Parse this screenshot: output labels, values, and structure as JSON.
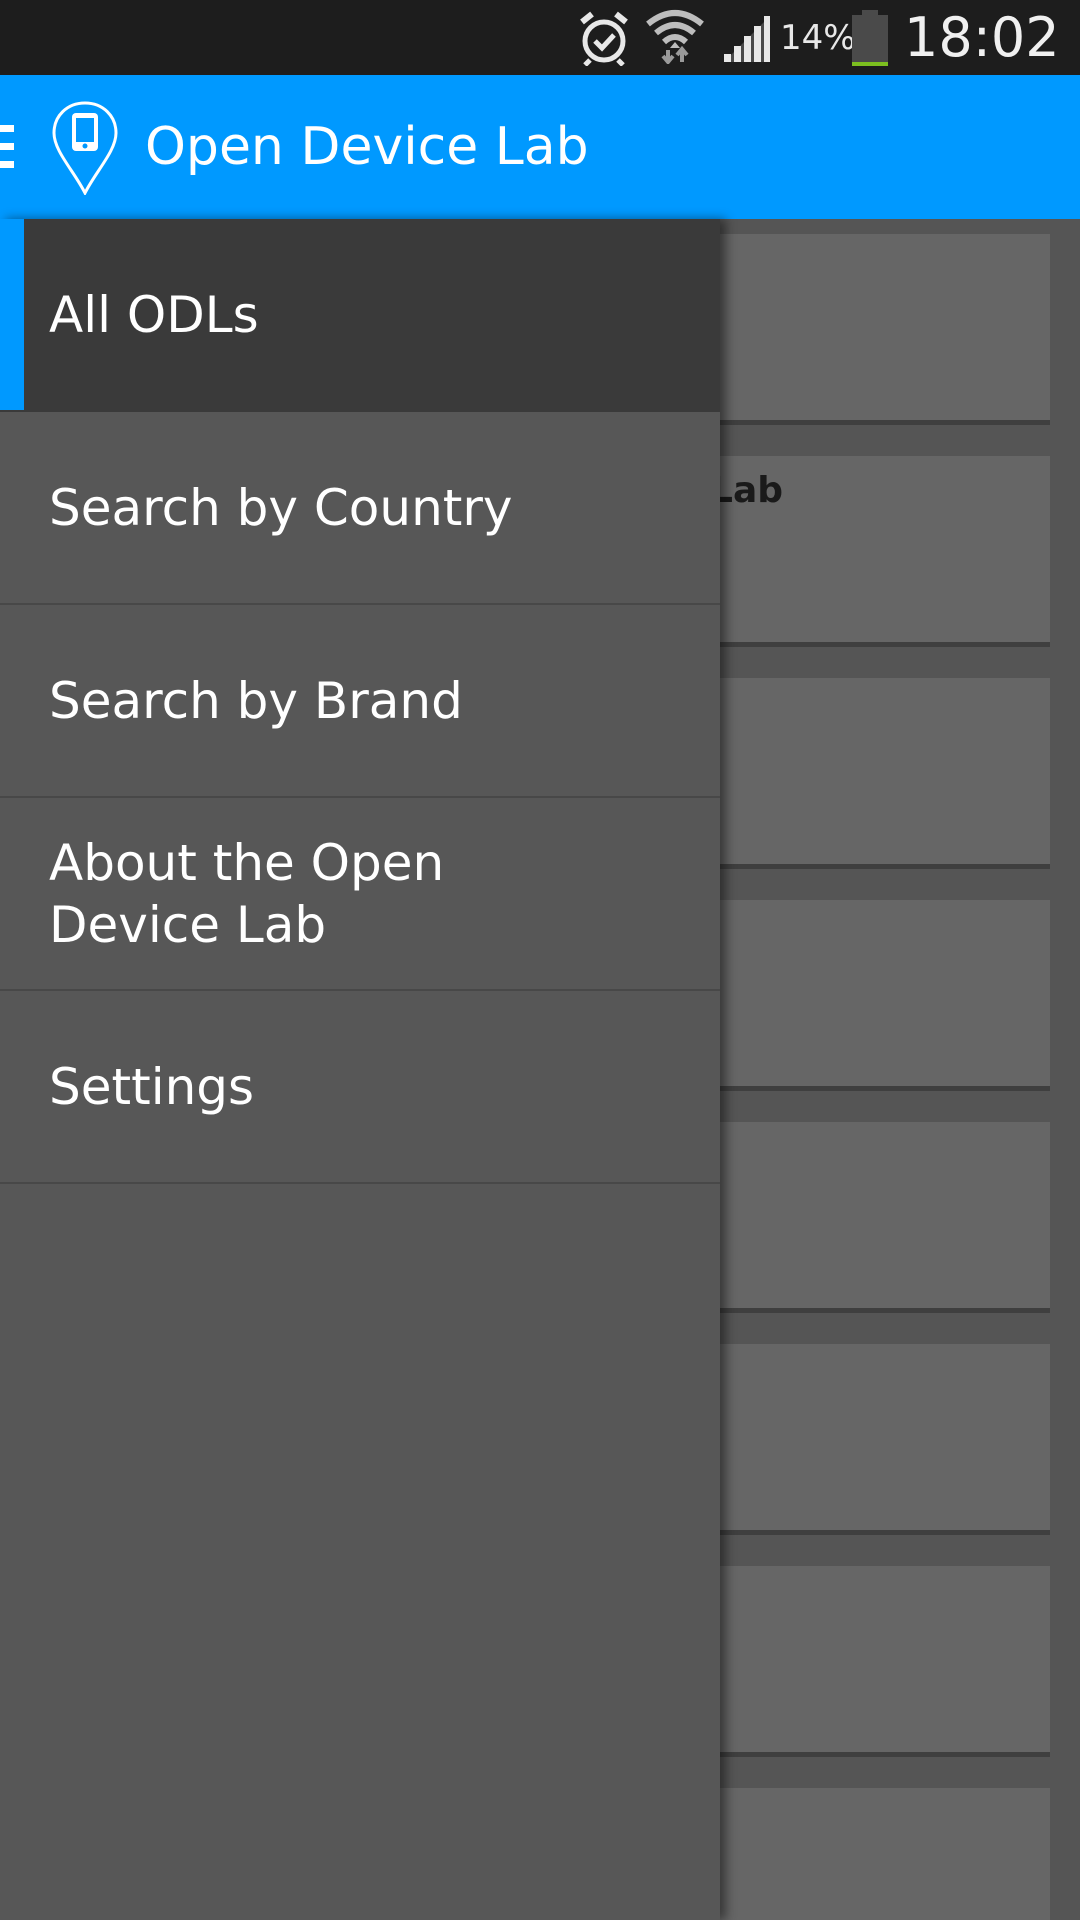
{
  "status_bar": {
    "battery_percent": "14%",
    "battery_level": 0.14,
    "time": "18:02",
    "icons": [
      "alarm-icon",
      "wifi-icon",
      "signal-icon",
      "battery-icon"
    ]
  },
  "action_bar": {
    "title": "Open Device Lab",
    "icons": [
      "hamburger-icon",
      "device-pin-logo-icon"
    ],
    "color": "#0099ff"
  },
  "drawer": {
    "items": [
      {
        "label": "All ODLs",
        "active": true
      },
      {
        "label": "Search by Country",
        "active": false
      },
      {
        "label": "Search by Brand",
        "active": false
      },
      {
        "label": "About the Open Device Lab",
        "active": false
      },
      {
        "label": "Settings",
        "active": false
      }
    ],
    "active_color": "#0099ff"
  },
  "content": {
    "cards": [
      {
        "title": ""
      },
      {
        "title": "Lab"
      },
      {
        "title": ""
      },
      {
        "title": ""
      },
      {
        "title": ""
      },
      {
        "title": ""
      },
      {
        "title": ""
      },
      {
        "title": ""
      }
    ]
  }
}
